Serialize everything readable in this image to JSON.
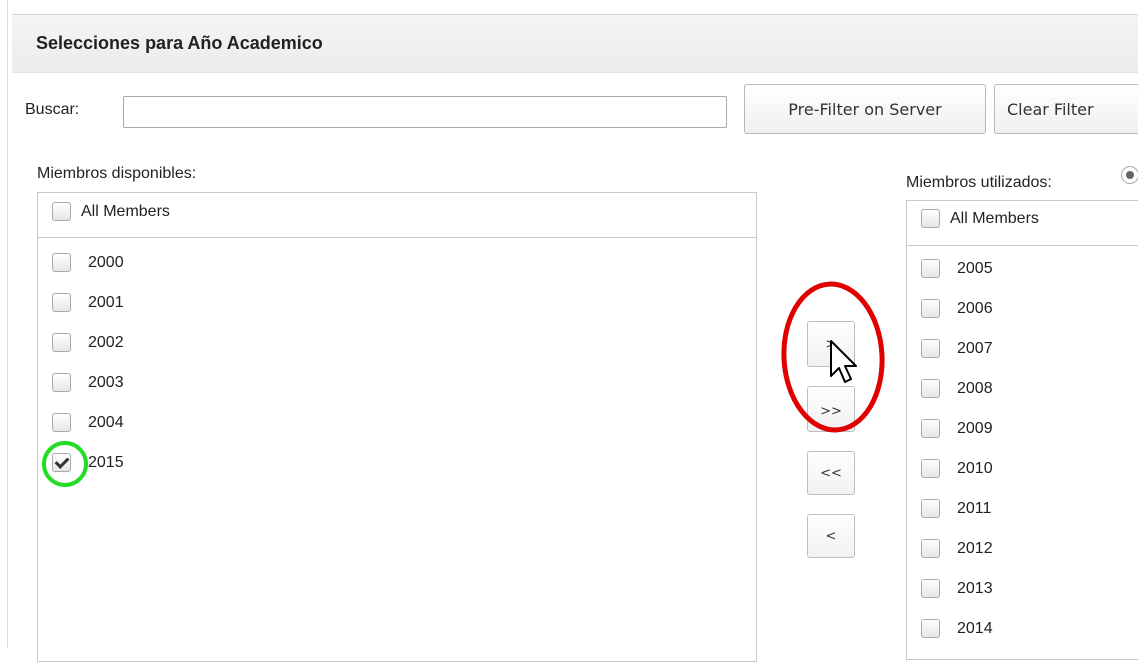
{
  "header": {
    "title": "Selecciones para Año Academico"
  },
  "search": {
    "label": "Buscar:",
    "value": "",
    "placeholder": ""
  },
  "buttons": {
    "prefilter": "Pre-Filter on Server",
    "clear": "Clear Filter"
  },
  "available": {
    "label": "Miembros disponibles:",
    "all_label": "All Members",
    "items": [
      {
        "label": "2000",
        "checked": false
      },
      {
        "label": "2001",
        "checked": false
      },
      {
        "label": "2002",
        "checked": false
      },
      {
        "label": "2003",
        "checked": false
      },
      {
        "label": "2004",
        "checked": false
      },
      {
        "label": "2015",
        "checked": true
      }
    ]
  },
  "used": {
    "label": "Miembros utilizados:",
    "all_label": "All Members",
    "items": [
      {
        "label": "2005",
        "checked": false
      },
      {
        "label": "2006",
        "checked": false
      },
      {
        "label": "2007",
        "checked": false
      },
      {
        "label": "2008",
        "checked": false
      },
      {
        "label": "2009",
        "checked": false
      },
      {
        "label": "2010",
        "checked": false
      },
      {
        "label": "2011",
        "checked": false
      },
      {
        "label": "2012",
        "checked": false
      },
      {
        "label": "2013",
        "checked": false
      },
      {
        "label": "2014",
        "checked": false
      }
    ]
  },
  "move_buttons": {
    "add": ">",
    "add_all": ">>",
    "remove_all": "<<",
    "remove": "<"
  },
  "annotations": {
    "red_circle_color": "#e00000",
    "green_circle_color": "#22dd22"
  }
}
